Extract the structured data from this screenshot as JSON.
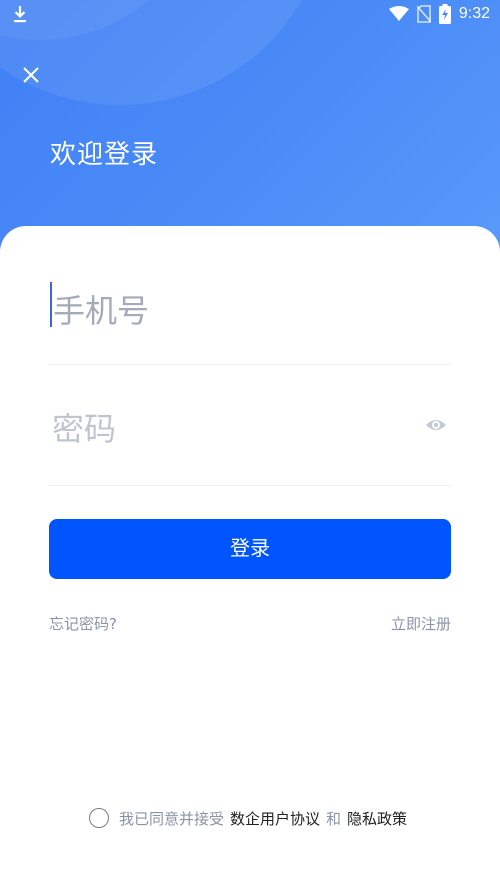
{
  "status_bar": {
    "time": "9:32",
    "icons": [
      "download-icon",
      "wifi-icon",
      "no-sim-icon",
      "battery-charging-icon"
    ]
  },
  "header": {
    "close_icon": "close-icon",
    "title": "欢迎登录"
  },
  "form": {
    "phone_placeholder": "手机号",
    "password_placeholder": "密码",
    "eye_icon": "eye-icon",
    "login_label": "登录"
  },
  "links": {
    "forgot_password": "忘记密码?",
    "register": "立即注册"
  },
  "agreement": {
    "prefix": "我已同意并接受",
    "user_agreement": "数企用户协议",
    "and": "和",
    "privacy_policy": "隐私政策"
  },
  "colors": {
    "primary": "#0055ff",
    "header_gradient_start": "#3f7ff5",
    "header_gradient_end": "#5a9bfb",
    "muted_text": "#8a94a6"
  }
}
